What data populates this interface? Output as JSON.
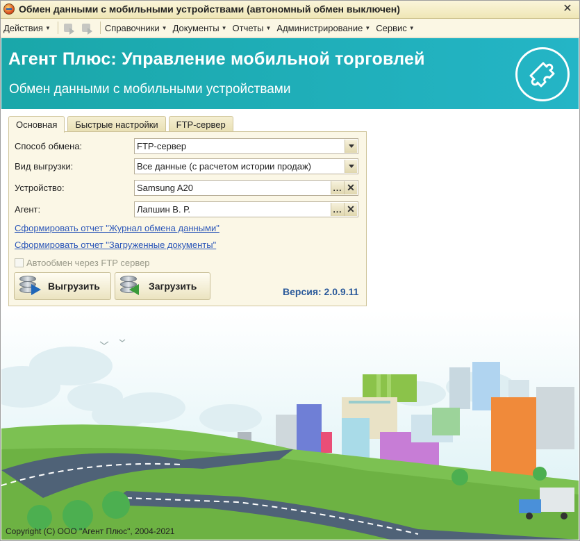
{
  "window": {
    "title": "Обмен данными с мобильными устройствами (автономный обмен выключен)",
    "close_icon": "close-icon"
  },
  "menu": {
    "items": [
      "Действия",
      "Справочники",
      "Документы",
      "Отчеты",
      "Администрирование",
      "Сервис"
    ]
  },
  "banner": {
    "title": "Агент Плюс: Управление мобильной торговлей",
    "subtitle": "Обмен данными с мобильными устройствами",
    "logo_icon": "puzzle-icon",
    "color": "#1fb0b8"
  },
  "tabs": [
    "Основная",
    "Быстрые настройки",
    "FTP-сервер"
  ],
  "form": {
    "exchange_method_label": "Способ обмена:",
    "exchange_method_value": "FTP-сервер",
    "export_type_label": "Вид выгрузки:",
    "export_type_value": "Все данные (с расчетом истории продаж)",
    "device_label": "Устройство:",
    "device_value": "Samsung A20",
    "agent_label": "Агент:",
    "agent_value": "Лапшин В. Р.",
    "link_journal": "Сформировать отчет \"Журнал обмена данными\"",
    "link_loaded": "Сформировать отчет \"Загруженные документы\"",
    "auto_exchange_label": "Автообмен через FTP сервер",
    "auto_exchange_checked": false,
    "export_button": "Выгрузить",
    "import_button": "Загрузить",
    "version": "Версия: 2.0.9.11"
  },
  "footer": {
    "copyright": "Copyright (C) ООО \"Агент Плюс\", 2004-2021"
  }
}
